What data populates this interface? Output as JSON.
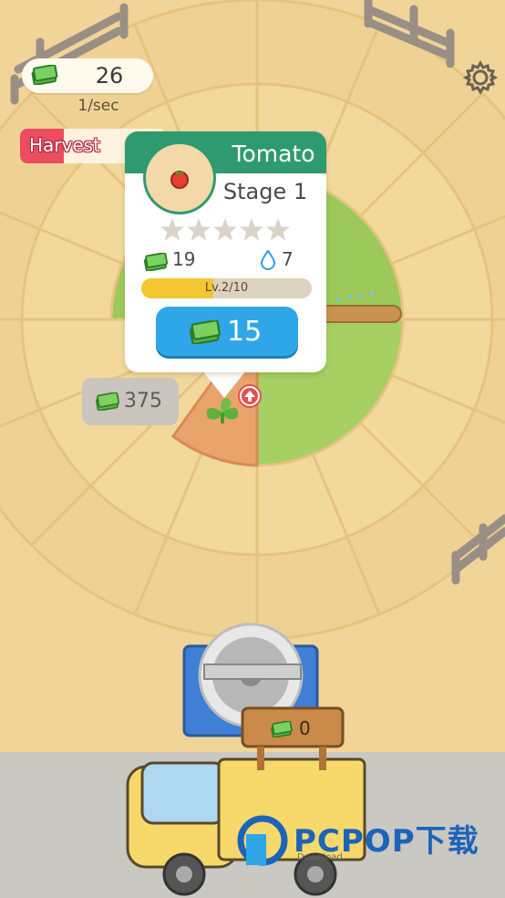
{
  "hud": {
    "money": "26",
    "rate": "1/sec",
    "harvest_label": "Harvest",
    "harvest_progress": 0.3
  },
  "popup": {
    "title": "Tomato",
    "stage": "Stage 1",
    "stars_filled": 0,
    "stars_total": 5,
    "cost": "19",
    "water": "7",
    "level_text": "Lv.2/10",
    "level_progress": 0.42,
    "buy_price": "15"
  },
  "plot_price": "375",
  "crate_value": "0",
  "watermark": {
    "text": "PCPOP下载",
    "sub": "Download"
  },
  "colors": {
    "accent_green": "#2f9a6f",
    "button_blue": "#2fa6e8",
    "harvest_red": "#ea4d60",
    "field_green": "#9cc95a",
    "ground": "#f1d498"
  },
  "icons": {
    "money": "cash-icon",
    "water": "water-drop-icon",
    "settings": "gear-icon",
    "upgrade": "upgrade-arrow-icon"
  }
}
